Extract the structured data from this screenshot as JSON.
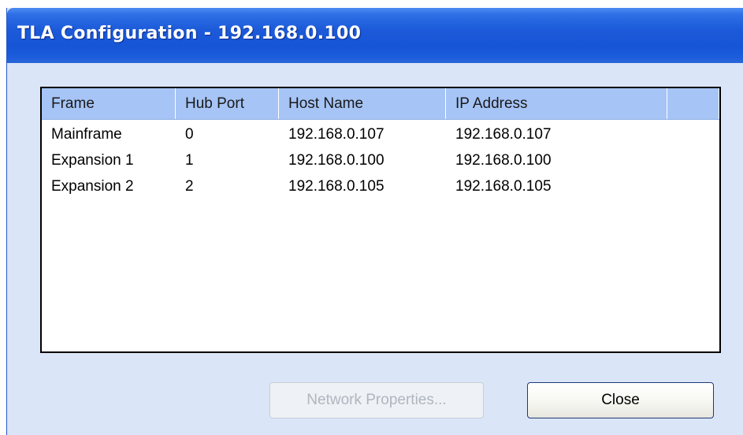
{
  "window": {
    "title": "TLA Configuration - 192.168.0.100"
  },
  "table": {
    "columns": [
      "Frame",
      "Hub Port",
      "Host Name",
      "IP Address",
      ""
    ],
    "rows": [
      [
        "Mainframe",
        "0",
        "192.168.0.107",
        "192.168.0.107"
      ],
      [
        "Expansion 1",
        "1",
        "192.168.0.100",
        "192.168.0.100"
      ],
      [
        "Expansion 2",
        "2",
        "192.168.0.105",
        "192.168.0.105"
      ]
    ]
  },
  "buttons": {
    "network_properties": "Network Properties...",
    "close": "Close"
  },
  "colors": {
    "titlebar": "#1655d6",
    "window_bg": "#dbe5f8",
    "header_bg": "#a6c4f5"
  }
}
